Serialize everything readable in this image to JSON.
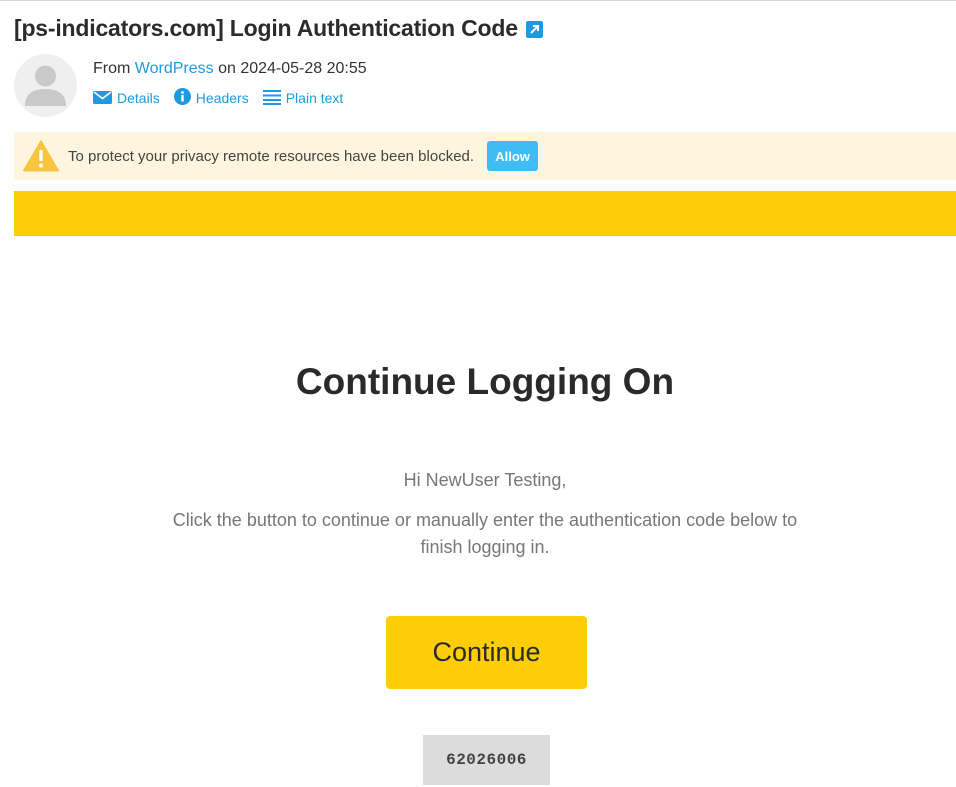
{
  "message": {
    "subject": "[ps-indicators.com] Login Authentication Code",
    "from_label": "From",
    "sender": "WordPress",
    "on_label": "on",
    "date": "2024-05-28 20:55"
  },
  "actions": {
    "details": "Details",
    "headers": "Headers",
    "plain_text": "Plain text"
  },
  "privacy": {
    "text": "To protect your privacy remote resources have been blocked.",
    "allow_label": "Allow"
  },
  "email": {
    "heading": "Continue Logging On",
    "greeting": "Hi NewUser Testing,",
    "instructions": "Click the button to continue or manually enter the authentication code below to finish logging in.",
    "button_label": "Continue",
    "code": "62026006"
  },
  "colors": {
    "link": "#1e9be0",
    "brand_yellow": "#fdcd05",
    "allow_button": "#3ebcf3",
    "privacy_background": "#fdf5de",
    "code_background": "#dcdcdc"
  },
  "icons": {
    "subject": "external-link-icon",
    "avatar": "user-avatar-icon",
    "details": "envelope-icon",
    "headers": "info-icon",
    "plain_text": "lines-icon",
    "privacy": "warning-icon"
  }
}
